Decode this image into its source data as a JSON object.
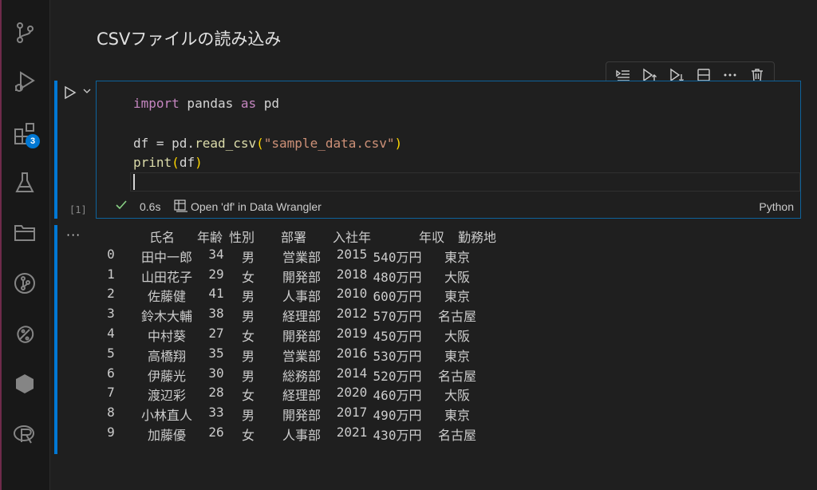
{
  "activity_bar": {
    "icons": [
      "source-control-icon",
      "run-debug-icon",
      "extensions-icon",
      "testing-icon",
      "explorer-icon",
      "git-graph-icon",
      "python-icon",
      "hexagon-icon",
      "r-language-icon"
    ],
    "extensions_badge": "3",
    "edge_color": "#6e2a4a"
  },
  "markdown": {
    "title": "CSVファイルの読み込み"
  },
  "cell_toolbar": {
    "icons": [
      "execute-above-icon",
      "execute-cell-and-below-icon",
      "execute-below-icon",
      "split-cell-icon",
      "more-icon",
      "delete-icon"
    ]
  },
  "code_cell": {
    "lines": {
      "l1": {
        "kw1": "import",
        "t1": " pandas ",
        "kw2": "as",
        "t2": " pd"
      },
      "l2": {
        "t1": "df = pd.",
        "fn": "read_csv",
        "p1": "(",
        "str": "\"sample_data.csv\"",
        "p2": ")"
      },
      "l3": {
        "fn": "print",
        "p1": "(",
        "t1": "df",
        "p2": ")"
      }
    },
    "execution_count": "[1]",
    "duration": "0.6s",
    "data_wrangler_label": "Open 'df' in Data Wrangler",
    "language": "Python"
  },
  "output": {
    "more": "···",
    "header": [
      "氏名",
      "年齢",
      "性別",
      "部署",
      "入社年",
      "年収",
      "勤務地"
    ],
    "rows": [
      [
        "0",
        "田中一郎",
        "34",
        "男",
        "営業部",
        "2015",
        "540万円",
        "東京"
      ],
      [
        "1",
        "山田花子",
        "29",
        "女",
        "開発部",
        "2018",
        "480万円",
        "大阪"
      ],
      [
        "2",
        "佐藤健",
        "41",
        "男",
        "人事部",
        "2010",
        "600万円",
        "東京"
      ],
      [
        "3",
        "鈴木大輔",
        "38",
        "男",
        "経理部",
        "2012",
        "570万円",
        "名古屋"
      ],
      [
        "4",
        "中村葵",
        "27",
        "女",
        "開発部",
        "2019",
        "450万円",
        "大阪"
      ],
      [
        "5",
        "高橋翔",
        "35",
        "男",
        "営業部",
        "2016",
        "530万円",
        "東京"
      ],
      [
        "6",
        "伊藤光",
        "30",
        "男",
        "総務部",
        "2014",
        "520万円",
        "名古屋"
      ],
      [
        "7",
        "渡辺彩",
        "28",
        "女",
        "経理部",
        "2020",
        "460万円",
        "大阪"
      ],
      [
        "8",
        "小林直人",
        "33",
        "男",
        "開発部",
        "2017",
        "490万円",
        "東京"
      ],
      [
        "9",
        "加藤優",
        "26",
        "女",
        "人事部",
        "2021",
        "430万円",
        "名古屋"
      ]
    ]
  },
  "colors": {
    "accent": "#0078d4",
    "success": "#89d185"
  }
}
